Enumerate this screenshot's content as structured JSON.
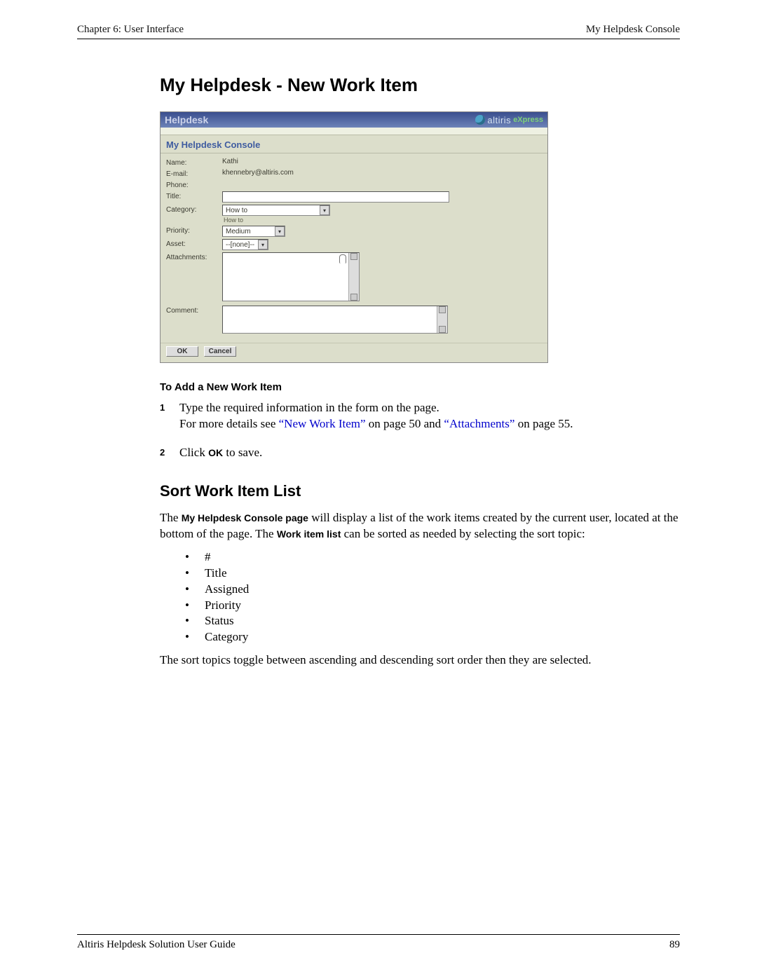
{
  "header": {
    "left": "Chapter 6: User Interface",
    "right": "My Helpdesk Console"
  },
  "footer": {
    "left": "Altiris Helpdesk Solution User Guide",
    "right": "89"
  },
  "section1_title": "My Helpdesk - New Work Item",
  "app": {
    "title": "Helpdesk",
    "brand_name": "altiris",
    "brand_suffix": "eXpress",
    "subtitle": "My Helpdesk Console",
    "labels": {
      "name": "Name:",
      "email": "E-mail:",
      "phone": "Phone:",
      "title": "Title:",
      "category": "Category:",
      "priority": "Priority:",
      "asset": "Asset:",
      "attachments": "Attachments:",
      "comment": "Comment:"
    },
    "values": {
      "name": "Kathi",
      "email": "khennebry@altiris.com",
      "category": "How to",
      "category_hint": "How to",
      "priority": "Medium",
      "asset": "--[none]--"
    },
    "buttons": {
      "ok": "OK",
      "cancel": "Cancel"
    }
  },
  "proc_title": "To Add a New Work Item",
  "step1_a": "Type the required information in the form on the page.",
  "step1_b_pre": "For more details see ",
  "step1_link1": "“New Work Item”",
  "step1_mid1": " on page 50 and ",
  "step1_link2": "“Attachments”",
  "step1_mid2": " on page 55.",
  "step2_pre": "Click ",
  "step2_ok": "OK",
  "step2_post": " to save.",
  "section2_title": "Sort Work Item List",
  "sort_para_1a": "The ",
  "sort_bold1": "My Helpdesk Console page",
  "sort_para_1b": " will display a list of the work items created by the current user, located at the bottom of the page. The ",
  "sort_bold2": "Work item list",
  "sort_para_1c": " can be sorted as needed by selecting the sort topic:",
  "sort_items": [
    "#",
    "Title",
    "Assigned",
    "Priority",
    "Status",
    "Category"
  ],
  "sort_para_2": "The sort topics toggle between ascending and descending sort order then they are selected."
}
